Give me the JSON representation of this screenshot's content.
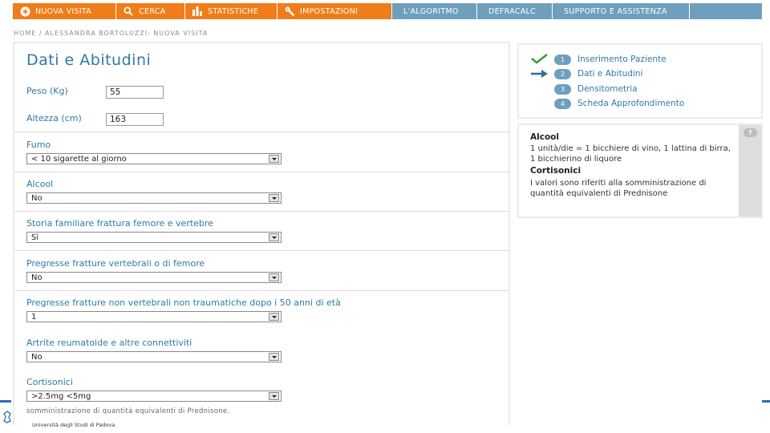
{
  "nav": {
    "items": [
      {
        "label": "NUOVA VISITA",
        "icon": "plus-circle-icon"
      },
      {
        "label": "CERCA",
        "icon": "search-icon"
      },
      {
        "label": "STATISTICHE",
        "icon": "bar-chart-icon"
      },
      {
        "label": "IMPOSTAZIONI",
        "icon": "wrench-icon"
      },
      {
        "label": "L'ALGORITMO"
      },
      {
        "label": "DEFRACALC"
      },
      {
        "label": "SUPPORTO E ASSISTENZA"
      }
    ],
    "colors": {
      "orange": "#ef7d1a",
      "blue": "#6f9fbe"
    }
  },
  "breadcrumb": "HOME / ALESSANDRA BORTOLUZZI: NUOVA VISITA",
  "form": {
    "title": "Dati e Abitudini",
    "peso": {
      "label": "Peso (Kg)",
      "value": "55"
    },
    "altezza": {
      "label": "Altezza (cm)",
      "value": "163"
    },
    "fumo": {
      "label": "Fumo",
      "value": "< 10 sigarette al giorno"
    },
    "alcool": {
      "label": "Alcool",
      "value": "No"
    },
    "storia": {
      "label": "Storia familiare frattura femore e vertebre",
      "value": "Sì"
    },
    "fratture_vert": {
      "label": "Pregresse fratture vertebrali o di femore",
      "value": "No"
    },
    "fratture_nonvert": {
      "label": "Pregresse fratture non vertebrali non traumatiche dopo i 50 anni di età",
      "value": "1"
    },
    "artrite": {
      "label": "Artrite reumatoide e altre connettiviti",
      "value": "No"
    },
    "cortisonici": {
      "label": "Cortisonici",
      "value": ">2.5mg <5mg"
    },
    "note": "somministrazione di quantità equivalenti di Prednisone."
  },
  "steps": [
    {
      "num": "1",
      "label": "Inserimento Paziente",
      "status": "completed"
    },
    {
      "num": "2",
      "label": "Dati e Abitudini",
      "status": "current"
    },
    {
      "num": "3",
      "label": "Densitometria",
      "status": "pending"
    },
    {
      "num": "4",
      "label": "Scheda Approfondimento",
      "status": "pending"
    }
  ],
  "info": {
    "help": "?",
    "alcool_title": "Alcool",
    "alcool_text": "1 unità/die = 1 bicchiere di vino, 1 lattina di birra, 1 bicchierino di liquore",
    "cortisonici_title": "Cortisonici",
    "cortisonici_text": "I valori sono riferiti alla somministrazione di quantità equivalenti di Prednisone"
  },
  "footer": {
    "text": "Università degli Studi di Padova"
  },
  "colors": {
    "accent": "#2e7aa6",
    "check": "#3a9a3a",
    "arrow": "#2e6fa0"
  }
}
